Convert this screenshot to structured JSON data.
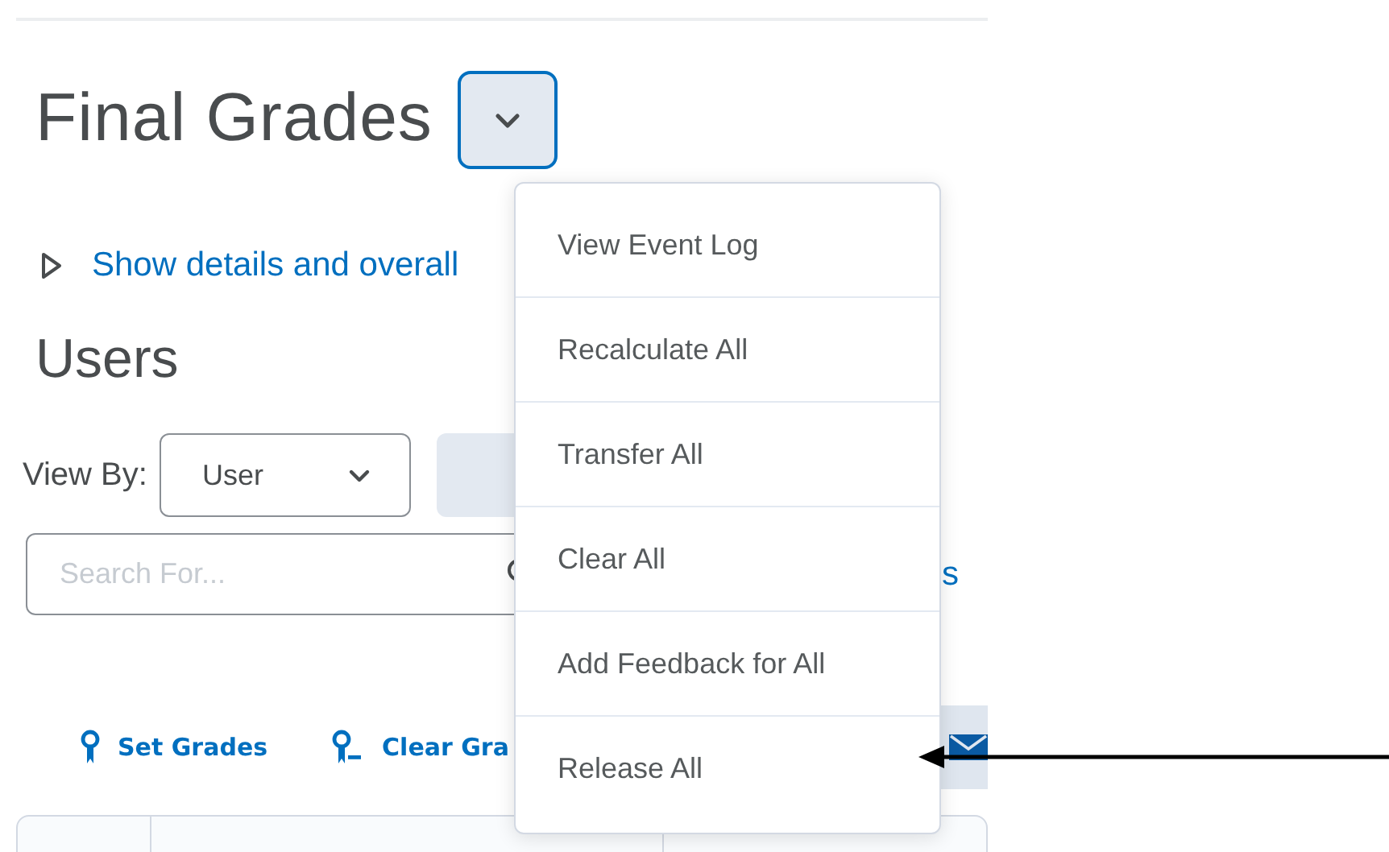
{
  "page_title": "Final Grades",
  "actions_menu": {
    "expanded": true,
    "items": [
      {
        "label": "View Event Log"
      },
      {
        "label": "Recalculate All"
      },
      {
        "label": "Transfer All"
      },
      {
        "label": "Clear All"
      },
      {
        "label": "Add Feedback for All"
      },
      {
        "label": "Release All"
      }
    ]
  },
  "details_toggle": {
    "expanded": false,
    "label": "Show details and overall"
  },
  "section_title": "Users",
  "view_by": {
    "label": "View By:",
    "value": "User"
  },
  "search": {
    "placeholder": "Search For..."
  },
  "options_link": "s",
  "toolbar": [
    {
      "label": "Set Grades",
      "kind": "set"
    },
    {
      "label": "Clear Gra",
      "kind": "clear"
    }
  ]
}
